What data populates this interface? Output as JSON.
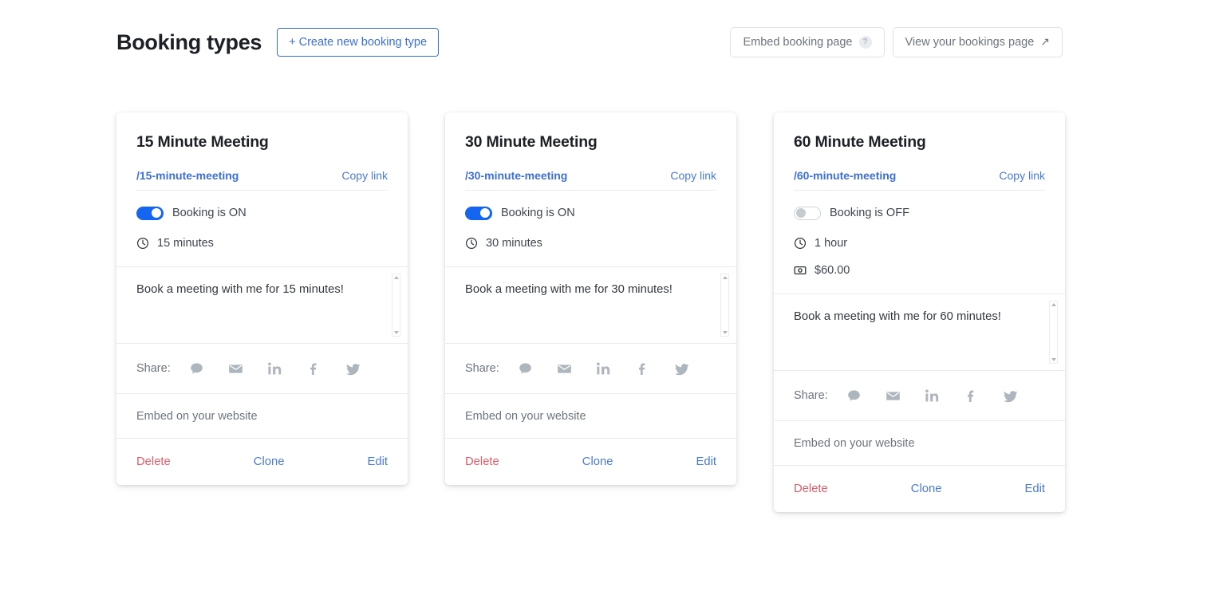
{
  "header": {
    "title": "Booking types",
    "create_label": "+ Create new booking type",
    "embed_label": "Embed booking page",
    "help_badge": "?",
    "view_label": "View your bookings page",
    "external_arrow": "↗"
  },
  "labels": {
    "copy_link": "Copy link",
    "share": "Share:",
    "embed_on_site": "Embed on your website",
    "delete": "Delete",
    "clone": "Clone",
    "edit": "Edit"
  },
  "colors": {
    "accent_blue": "#1565f0",
    "link_blue": "#4a7ad8",
    "slug_blue": "#3d6fd6",
    "delete_red": "#e05c68",
    "icon_gray": "#adb5bd",
    "border_gray": "#e9ecef"
  },
  "cards": [
    {
      "title": "15 Minute Meeting",
      "slug": "/15-minute-meeting",
      "booking_state": "on",
      "booking_label": "Booking is ON",
      "duration": "15 minutes",
      "price": null,
      "description": "Book a meeting with me for 15 minutes!"
    },
    {
      "title": "30 Minute Meeting",
      "slug": "/30-minute-meeting",
      "booking_state": "on",
      "booking_label": "Booking is ON",
      "duration": "30 minutes",
      "price": null,
      "description": "Book a meeting with me for 30 minutes!"
    },
    {
      "title": "60 Minute Meeting",
      "slug": "/60-minute-meeting",
      "booking_state": "off",
      "booking_label": "Booking is OFF",
      "duration": "1 hour",
      "price": "$60.00",
      "description": "Book a meeting with me for 60 minutes!"
    }
  ]
}
